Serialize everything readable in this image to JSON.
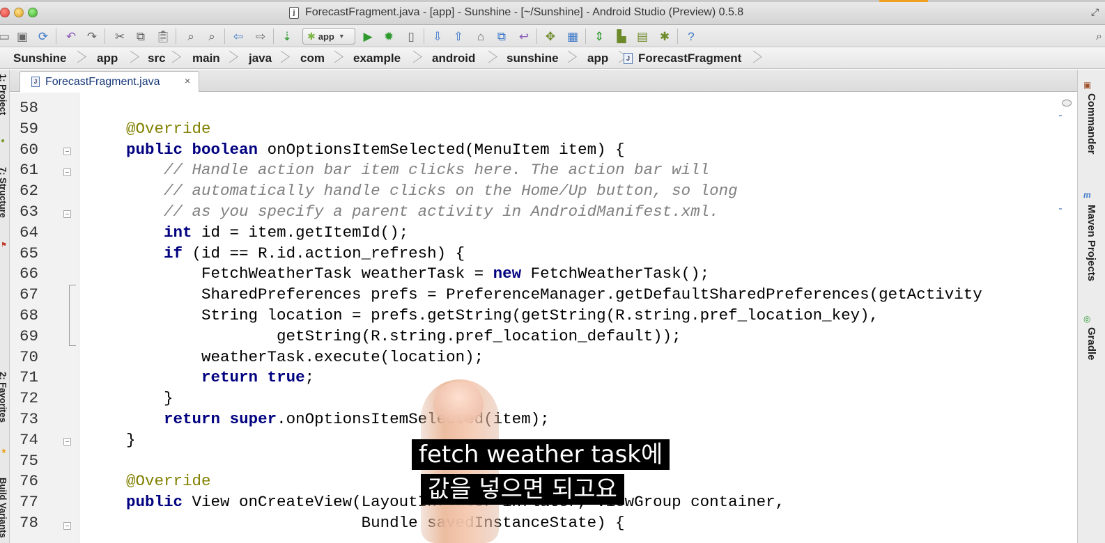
{
  "window": {
    "title": "ForecastFragment.java - [app] - Sunshine - [~/Sunshine] - Android Studio (Preview) 0.5.8",
    "file_icon_glyph": "j"
  },
  "toolbar": {
    "run_config": "app",
    "icons": [
      "folder-icon",
      "save-icon",
      "sync-icon",
      "undo-icon",
      "redo-icon",
      "cut-icon",
      "copy-icon",
      "paste-icon",
      "find-icon",
      "replace-icon",
      "back-icon",
      "forward-icon",
      "make-project-icon",
      "run-config-dropdown",
      "run-icon",
      "debug-icon",
      "attach-debugger-icon",
      "vcs-update-icon",
      "vcs-commit-icon",
      "vcs-compare-icon",
      "vcs-history-icon",
      "vcs-revert-icon",
      "project-structure-icon",
      "sdk-manager-icon",
      "avd-manager-icon",
      "sync-gradle-icon",
      "android-monitor-icon",
      "android-icon",
      "help-icon",
      "search-everywhere-icon"
    ]
  },
  "breadcrumb": [
    {
      "label": "Sunshine"
    },
    {
      "label": "app"
    },
    {
      "label": "src"
    },
    {
      "label": "main"
    },
    {
      "label": "java"
    },
    {
      "label": "com"
    },
    {
      "label": "example"
    },
    {
      "label": "android"
    },
    {
      "label": "sunshine"
    },
    {
      "label": "app"
    },
    {
      "label": "ForecastFragment"
    }
  ],
  "editor_tab": {
    "label": "ForecastFragment.java",
    "close": "×"
  },
  "left_tool_windows": {
    "project": "1: Project",
    "structure": "7: Structure",
    "favorites": "2: Favorites",
    "build_variants": "Build Variants"
  },
  "right_tool_windows": {
    "commander": "Commander",
    "maven": "Maven Projects",
    "gradle": "Gradle"
  },
  "code": {
    "lines": [
      {
        "num": "58",
        "text": ""
      },
      {
        "num": "59",
        "text": "    @Override"
      },
      {
        "num": "60",
        "text": "    public boolean onOptionsItemSelected(MenuItem item) {"
      },
      {
        "num": "61",
        "text": "        // Handle action bar item clicks here. The action bar will"
      },
      {
        "num": "62",
        "text": "        // automatically handle clicks on the Home/Up button, so long"
      },
      {
        "num": "63",
        "text": "        // as you specify a parent activity in AndroidManifest.xml."
      },
      {
        "num": "64",
        "text": "        int id = item.getItemId();"
      },
      {
        "num": "65",
        "text": "        if (id == R.id.action_refresh) {"
      },
      {
        "num": "66",
        "text": "            FetchWeatherTask weatherTask = new FetchWeatherTask();"
      },
      {
        "num": "67",
        "text": "            SharedPreferences prefs = PreferenceManager.getDefaultSharedPreferences(getActivity"
      },
      {
        "num": "68",
        "text": "            String location = prefs.getString(getString(R.string.pref_location_key),"
      },
      {
        "num": "69",
        "text": "                    getString(R.string.pref_location_default));"
      },
      {
        "num": "70",
        "text": "            weatherTask.execute(location);"
      },
      {
        "num": "71",
        "text": "            return true;"
      },
      {
        "num": "72",
        "text": "        }"
      },
      {
        "num": "73",
        "text": "        return super.onOptionsItemSelected(item);"
      },
      {
        "num": "74",
        "text": "    }"
      },
      {
        "num": "75",
        "text": ""
      },
      {
        "num": "76",
        "text": "    @Override"
      },
      {
        "num": "77",
        "text": "    public View onCreateView(LayoutInflater inflater, ViewGroup container,"
      },
      {
        "num": "78",
        "text": "                             Bundle savedInstanceState) {"
      }
    ]
  },
  "subtitles": {
    "line1": "fetch weather task에",
    "line2": "값을 넣으면 되고요"
  },
  "colors": {
    "keyword": "#000080",
    "comment": "#808080",
    "annotation": "#808000",
    "gutter": "#f2f2f2"
  }
}
